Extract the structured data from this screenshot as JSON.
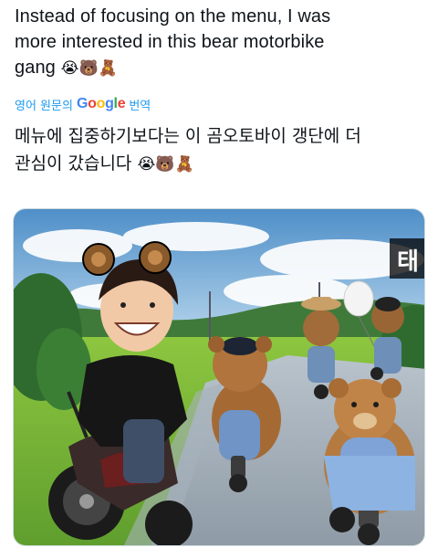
{
  "post": {
    "line1": "Instead of focusing on the menu, I was",
    "line2": "more interested in this bear motorbike",
    "line3": "gang",
    "emojis": "😭🐻🧸"
  },
  "translate": {
    "prefix": "영어 원문의",
    "brand": [
      "G",
      "o",
      "o",
      "g",
      "l",
      "e"
    ],
    "suffix": "번역"
  },
  "translation": {
    "line1": "메뉴에 집중하기보다는 이 곰오토바이 갱단에 더",
    "line2": "관심이 갔습니다",
    "emojis": "😭🐻🧸"
  },
  "media": {
    "corner_text": "태"
  }
}
